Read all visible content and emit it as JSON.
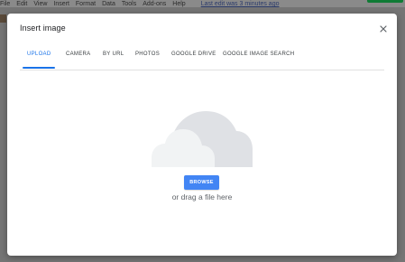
{
  "app": {
    "menu": [
      "File",
      "Edit",
      "View",
      "Insert",
      "Format",
      "Data",
      "Tools",
      "Add-ons",
      "Help"
    ],
    "last_edit": "Last edit was 3 minutes ago"
  },
  "dialog": {
    "title": "Insert image",
    "close_icon": "close-icon",
    "tabs": [
      {
        "label": "UPLOAD",
        "active": true
      },
      {
        "label": "CAMERA",
        "active": false
      },
      {
        "label": "BY URL",
        "active": false
      },
      {
        "label": "PHOTOS",
        "active": false
      },
      {
        "label": "GOOGLE DRIVE",
        "active": false
      },
      {
        "label": "GOOGLE IMAGE SEARCH",
        "active": false
      }
    ],
    "upload": {
      "illustration_icon": "cloud-icon",
      "browse_label": "BROWSE",
      "drag_text": "or drag a file here"
    }
  },
  "colors": {
    "accent": "#1a73e8",
    "button": "#4285f4",
    "cloud_back": "#dfe1e5",
    "cloud_front": "#f1f3f4"
  }
}
